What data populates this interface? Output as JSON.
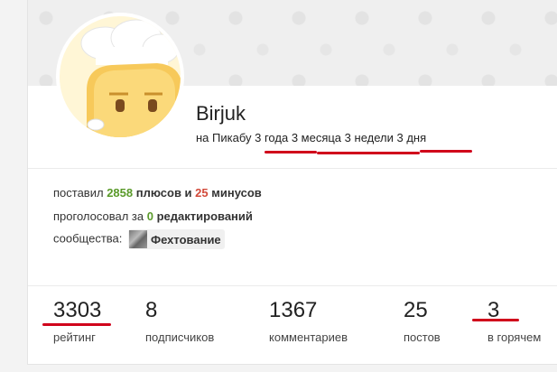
{
  "profile": {
    "username": "Birjuk",
    "since_prefix": "на Пикабу",
    "since_years": "3 года",
    "since_months": "3 месяца",
    "since_weeks": "3 недели",
    "since_days": "3 дня"
  },
  "info": {
    "votes_prefix": "поставил",
    "plus_count": "2858",
    "plus_word": "плюсов и",
    "minus_count": "25",
    "minus_word": "минусов",
    "edits_prefix": "проголосовал за",
    "edits_count": "0",
    "edits_word": "редактирований",
    "communities_label": "сообщества:",
    "community_name": "Фехтование"
  },
  "stats": [
    {
      "value": "3303",
      "label": "рейтинг"
    },
    {
      "value": "8",
      "label": "подписчиков"
    },
    {
      "value": "1367",
      "label": "комментариев"
    },
    {
      "value": "25",
      "label": "постов"
    },
    {
      "value": "3",
      "label": "в горячем"
    }
  ],
  "colors": {
    "annotation": "#d0021b",
    "plus": "#5a9a2a",
    "minus": "#d24a3a"
  }
}
